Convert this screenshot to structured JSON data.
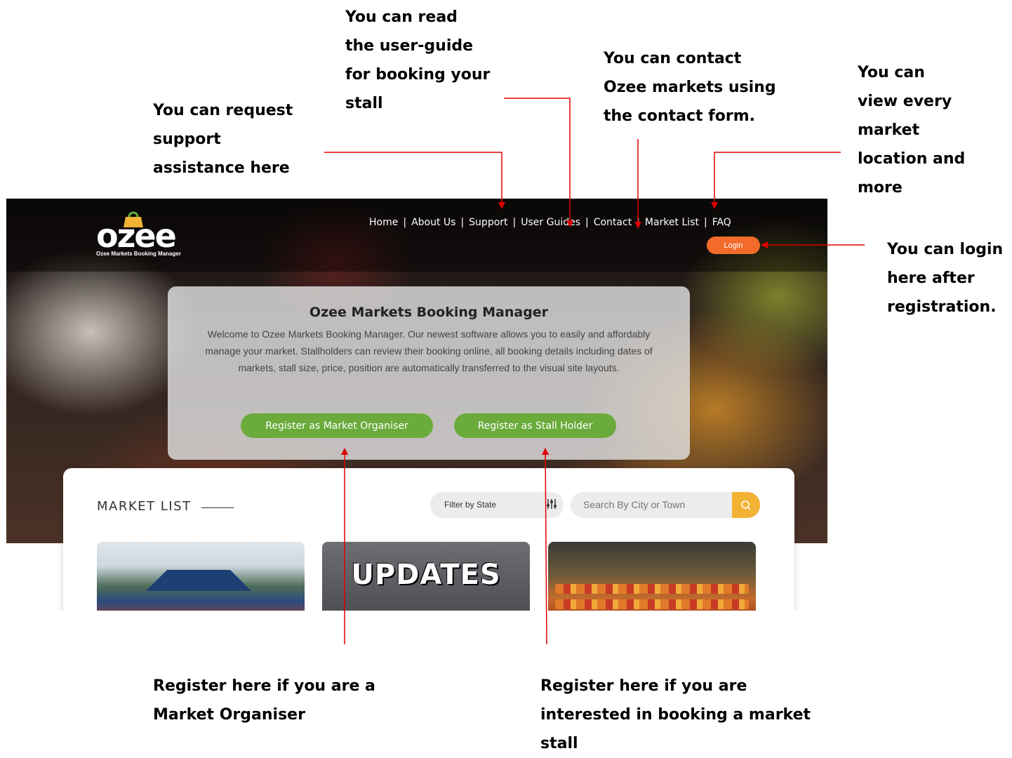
{
  "annotations": {
    "support": "You can request\nsupport\nassistance here",
    "user_guide": "You can read\nthe user-guide\nfor booking your\nstall",
    "contact": "You can contact\nOzee markets using\nthe contact form.",
    "market_list": "You can\nview every\nmarket\nlocation and\nmore",
    "login": "You can login\nhere after\nregistration.",
    "organiser": "Register here if you are a\nMarket Organiser",
    "stall_holder": "Register here if you are\ninterested in booking a market\nstall"
  },
  "header": {
    "logo_text": "ozee",
    "logo_tagline": "Ozee Markets Booking Manager",
    "nav": [
      "Home",
      "About Us",
      "Support",
      "User Guides",
      "Contact",
      "Market List",
      "FAQ"
    ],
    "nav_separator": "|",
    "login_label": "Login"
  },
  "welcome": {
    "title": "Ozee Markets Booking Manager",
    "body": "Welcome to Ozee Markets Booking Manager. Our newest software allows you to easily and affordably manage your market. Stallholders can review their booking online, all booking details including dates of markets, stall size, price, position are automatically transferred to the visual site layouts.",
    "register_organiser": "Register as Market Organiser",
    "register_stall_holder": "Register as Stall Holder"
  },
  "market_list": {
    "title": "MARKET LIST",
    "filter_label": "Filter by State",
    "search_placeholder": "Search By City or Town",
    "cards": [
      {
        "image": "market-tent-photo"
      },
      {
        "image": "updates-banner",
        "text": "UPDATES"
      },
      {
        "image": "fruit-stall-photo"
      }
    ]
  },
  "colors": {
    "arrow": "#e00000",
    "login": "#f26b2a",
    "register": "#6aab3b",
    "search_button": "#f2b233"
  }
}
